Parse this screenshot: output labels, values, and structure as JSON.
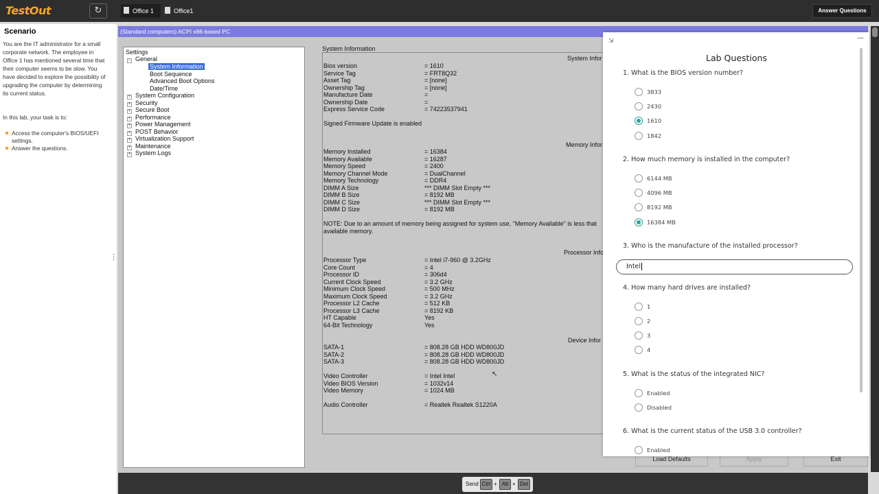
{
  "topbar": {
    "logo": "TestOut",
    "tabs": [
      "Office 1",
      "Office1"
    ],
    "answer_button": "Answer Questions"
  },
  "scenario": {
    "title": "Scenario",
    "paragraph1": "You are the IT administrator for a small corporate network. The employee in Office 1 has mentioned several time that their computer seems to be slow. You have decided to explore the possibility of upgrading the computer by determining its current status.",
    "paragraph2": "In this lab, your task is to:",
    "tasks": [
      "Access the computer's BIOS/UEFI settings.",
      "Answer the questions."
    ]
  },
  "bios": {
    "window_title": "(Standard computers) ACPI x86-based PC",
    "tree_root": "Settings",
    "tree": {
      "general": "General",
      "system_information": "System Information",
      "boot_sequence": "Boot Sequence",
      "advanced_boot": "Advanced Boot Options",
      "date_time": "Date/Time",
      "system_configuration": "System Configuration",
      "security": "Security",
      "secure_boot": "Secure Boot",
      "performance": "Performance",
      "power_management": "Power Management",
      "post_behavior": "POST Behavior",
      "virtualization": "Virtualization Support",
      "maintenance": "Maintenance",
      "system_logs": "System Logs"
    },
    "info_panel_label": "System Information",
    "section_headers": {
      "system": "System Infor",
      "memory": "Memory Infor",
      "processor": "Processor Infor",
      "device": "Device Infor"
    },
    "rows": {
      "bios_version_k": "Bios version",
      "bios_version_v": "= 1610",
      "service_tag_k": "Service Tag",
      "service_tag_v": "= FRT8Q32",
      "asset_tag_k": "Asset Tag",
      "asset_tag_v": "= [none]",
      "ownership_tag_k": "Ownership Tag",
      "ownership_tag_v": "= [none]",
      "manufacture_date_k": "Manufacture Date",
      "manufacture_date_v": "=",
      "ownership_date_k": "Ownership Date",
      "ownership_date_v": "=",
      "express_code_k": "Express Service Code",
      "express_code_v": "= 74223537941",
      "signed_fw": "Signed Firmware Update is enabled",
      "mem_installed_k": "Memory Installed",
      "mem_installed_v": "= 16384",
      "mem_available_k": "Memory Available",
      "mem_available_v": "= 16287",
      "mem_speed_k": "Memory Speed",
      "mem_speed_v": "= 2400",
      "mem_channel_k": "Memory Channel Mode",
      "mem_channel_v": "= DualChannel",
      "mem_tech_k": "Memory Technology",
      "mem_tech_v": "= DDR4",
      "dimm_a_k": "DIMM A Size",
      "dimm_a_v": "*** DIMM Slot Empty ***",
      "dimm_b_k": "DIMM B Size",
      "dimm_b_v": "= 8192 MB",
      "dimm_c_k": "DIMM C Size",
      "dimm_c_v": "*** DIMM Slot Empty ***",
      "dimm_d_k": "DIMM D Size",
      "dimm_d_v": "= 8192 MB",
      "note1": "NOTE: Due to an amount of memory being assigned for system use, \"Memory Available\" is less that",
      "note2": "available memory.",
      "proc_type_k": "Processor Type",
      "proc_type_v": "= Intel i7-960 @ 3.2GHz",
      "core_count_k": "Core Count",
      "core_count_v": "= 4",
      "proc_id_k": "Processor ID",
      "proc_id_v": "= 306d4",
      "cur_clock_k": "Current Clock Speed",
      "cur_clock_v": "= 3.2 GHz",
      "min_clock_k": "Minimum Clock Speed",
      "min_clock_v": "= 500 MHz",
      "max_clock_k": "Maximum Clock Speed",
      "max_clock_v": "= 3.2 GHz",
      "l2_k": "Processor L2 Cache",
      "l2_v": "= 512 KB",
      "l3_k": "Processor L3 Cache",
      "l3_v": "= 8192 KB",
      "ht_k": "HT Capable",
      "ht_v": "Yes",
      "bit64_k": "64-Bit Technology",
      "bit64_v": "Yes",
      "sata1_k": "SATA-1",
      "sata1_v": "= 808.28 GB HDD WD800JD",
      "sata2_k": "SATA-2",
      "sata2_v": "= 808.28 GB HDD WD800JD",
      "sata3_k": "SATA-3",
      "sata3_v": "= 808.28 GB HDD WD800JD",
      "video_ctrl_k": "Video Controller",
      "video_ctrl_v": "= Intel Intel",
      "video_bios_k": "Video BIOS Version",
      "video_bios_v": "= 1032v14",
      "video_mem_k": "Video Memory",
      "video_mem_v": "= 1024 MB",
      "audio_k": "Audio Controller",
      "audio_v": "= Realtek Realtek S1220A"
    },
    "buttons": {
      "load_defaults": "Load Defaults",
      "apply": "Apply",
      "exit": "Exit"
    }
  },
  "send_bar": {
    "send": "Send",
    "ctrl": "Ctrl",
    "alt": "Alt",
    "del": "Del",
    "plus": "+"
  },
  "lab": {
    "title": "Lab Questions",
    "q1": "1. What is the BIOS version number?",
    "q1_opts": [
      "3833",
      "2430",
      "1610",
      "1842"
    ],
    "q2": "2. How much memory is installed in the computer?",
    "q2_opts": [
      "6144 MB",
      "4096 MB",
      "8192 MB",
      "16384 MB"
    ],
    "q3": "3. Who is the manufacture of the installed processor?",
    "q3_value": "Intel",
    "q4": "4. How many hard drives are installed?",
    "q4_opts": [
      "1",
      "2",
      "3",
      "4"
    ],
    "q5": "5. What is the status of the integrated NIC?",
    "q5_opts": [
      "Enabled",
      "Disabled"
    ],
    "q6": "6. What is the current status of the USB 3.0 controller?",
    "q6_opts": [
      "Enabled"
    ],
    "colors": {
      "accent": "#2aa198",
      "brand": "#f5a623"
    }
  }
}
